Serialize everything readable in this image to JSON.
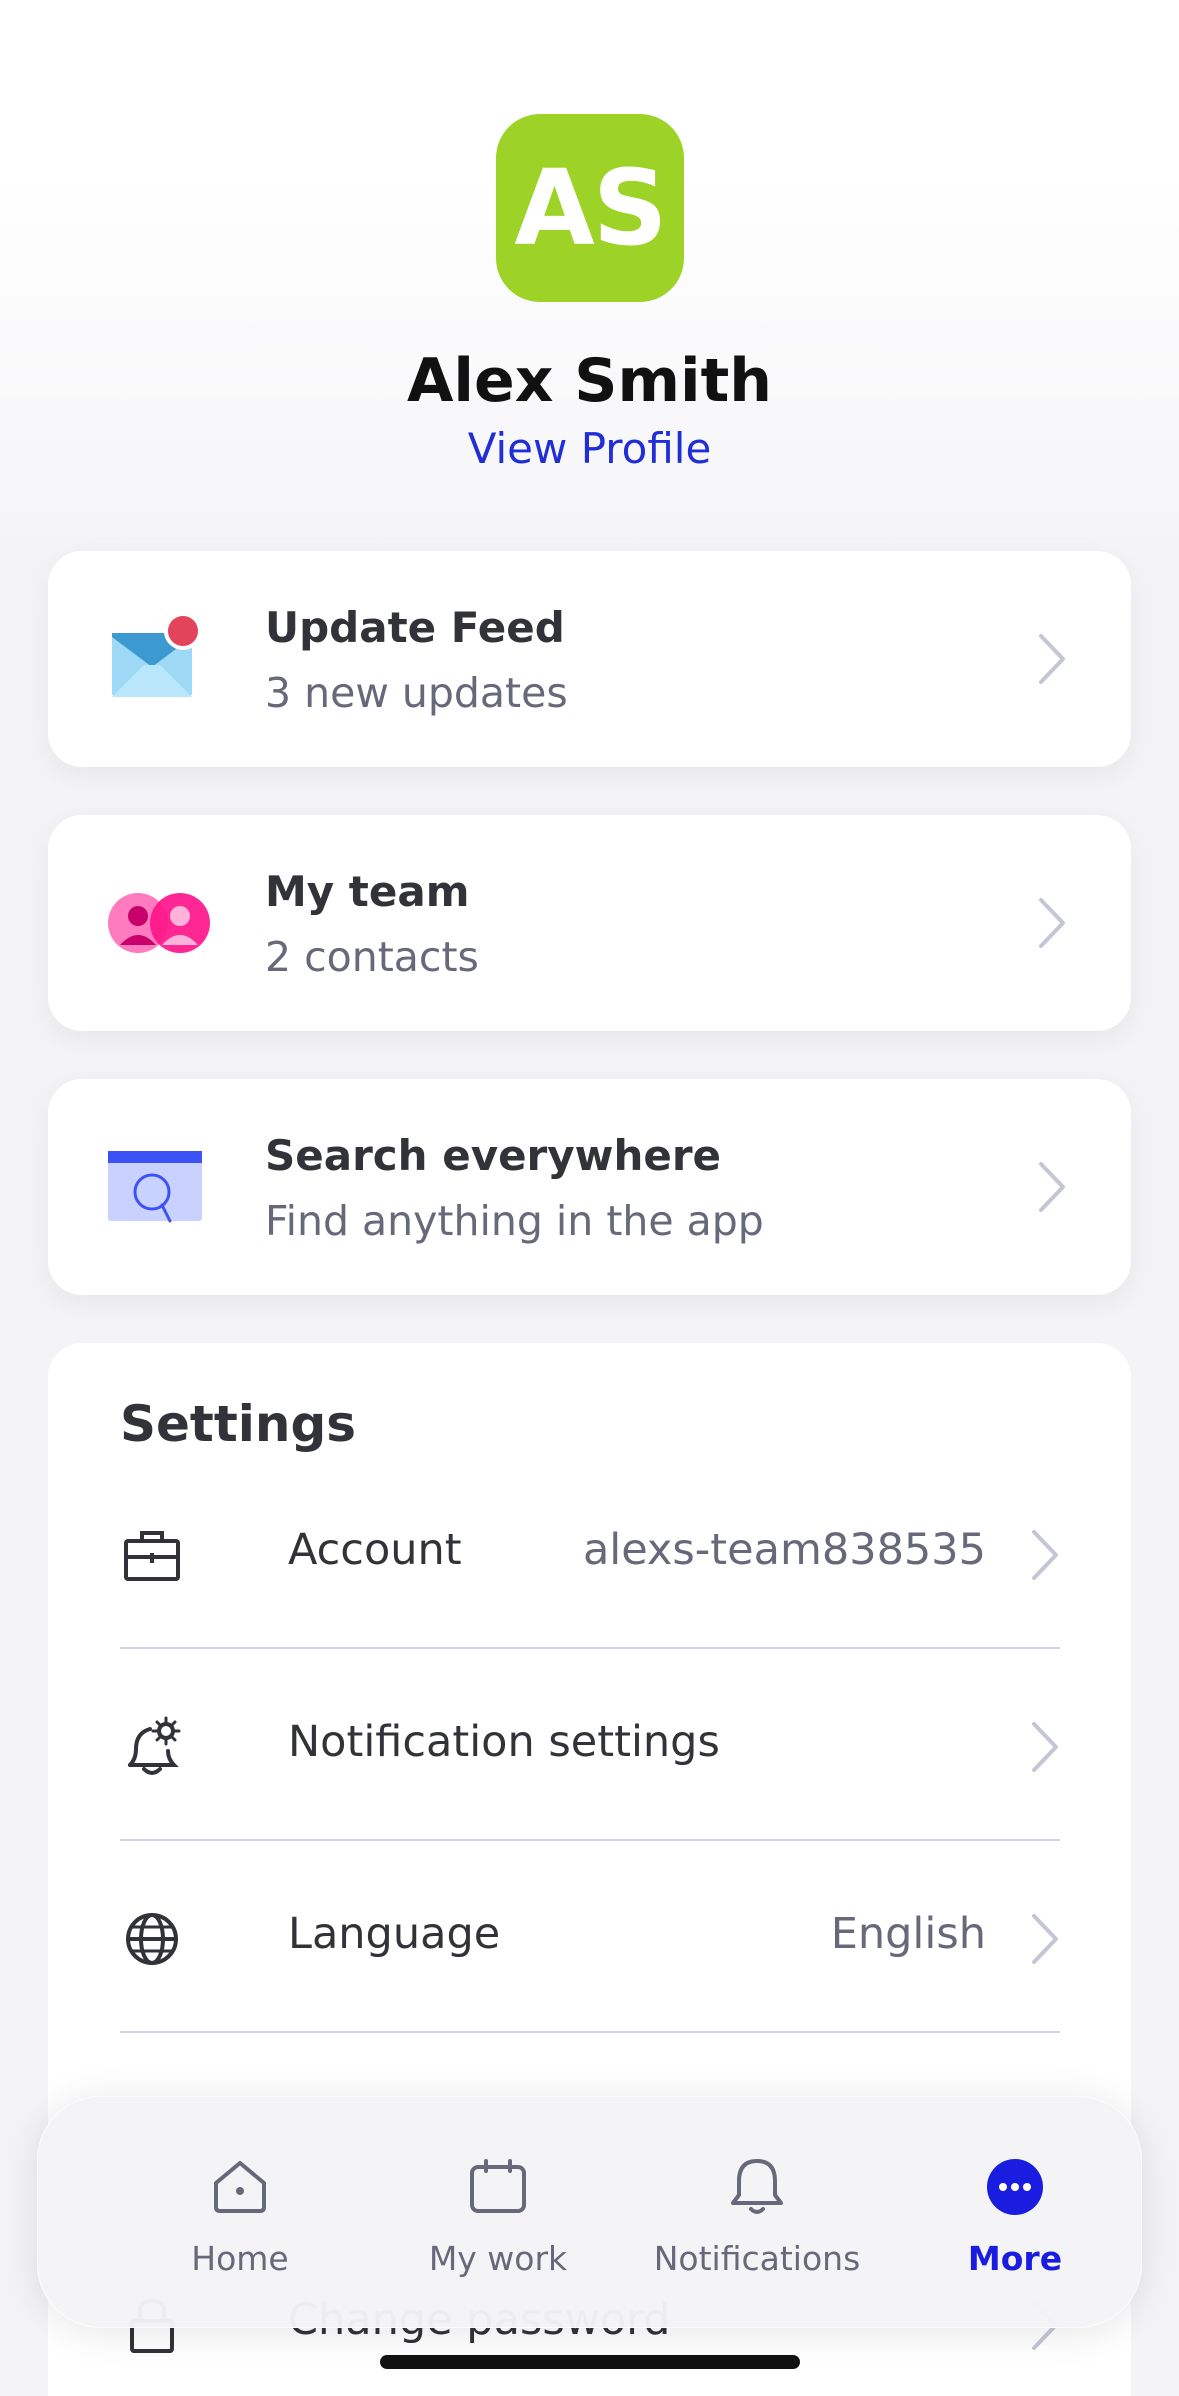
{
  "profile": {
    "initials": "AS",
    "name": "Alex Smith",
    "view_profile": "View Profile",
    "avatar_color": "#9cd326"
  },
  "cards": [
    {
      "title": "Update Feed",
      "subtitle": "3 new updates",
      "icon": "envelope-icon"
    },
    {
      "title": "My team",
      "subtitle": "2 contacts",
      "icon": "team-icon"
    },
    {
      "title": "Search everywhere",
      "subtitle": "Find anything in the app",
      "icon": "search-window-icon"
    }
  ],
  "settings": {
    "title": "Settings",
    "rows": [
      {
        "label": "Account",
        "value": "alexs-team838535",
        "icon": "briefcase-icon"
      },
      {
        "label": "Notification settings",
        "value": "",
        "icon": "bell-gear-icon"
      },
      {
        "label": "Language",
        "value": "English",
        "icon": "globe-icon"
      },
      {
        "label": "Change password",
        "value": "",
        "icon": "lock-icon"
      }
    ]
  },
  "tabs": [
    {
      "label": "Home",
      "icon": "home-icon"
    },
    {
      "label": "My work",
      "icon": "calendar-icon"
    },
    {
      "label": "Notifications",
      "icon": "bell-icon"
    },
    {
      "label": "More",
      "icon": "more-icon",
      "active": true
    }
  ],
  "colors": {
    "accent": "#1a1de0",
    "link": "#1f2ed6",
    "notification_dot": "#e2445c",
    "team_pink": "#ff158a"
  }
}
